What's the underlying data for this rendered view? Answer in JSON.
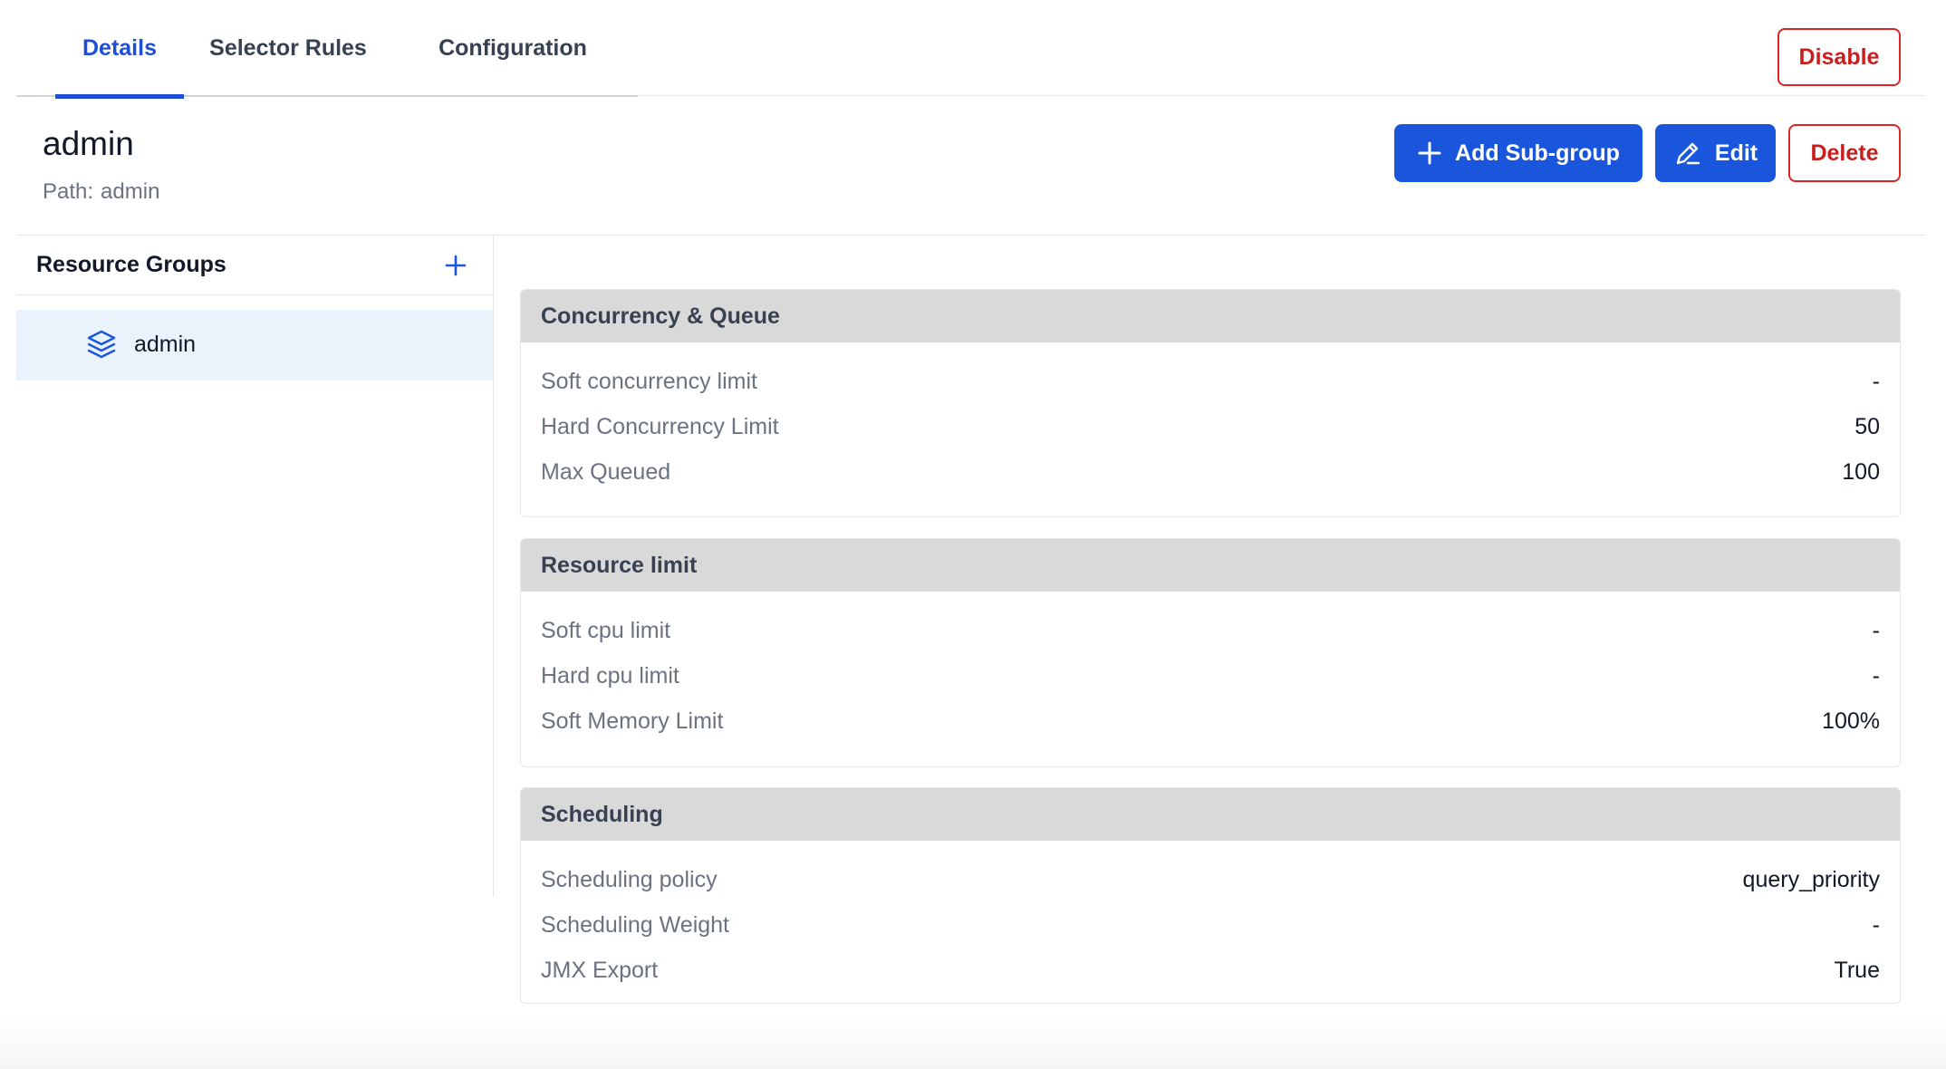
{
  "tabs": [
    {
      "label": "Details",
      "active": true
    },
    {
      "label": "Selector Rules",
      "active": false
    },
    {
      "label": "Configuration",
      "active": false
    }
  ],
  "actions": {
    "disable_label": "Disable",
    "add_subgroup_label": "Add Sub-group",
    "edit_label": "Edit",
    "delete_label": "Delete"
  },
  "group": {
    "name": "admin",
    "path_label": "Path:",
    "path_value": "admin"
  },
  "sidebar": {
    "title": "Resource Groups",
    "items": [
      {
        "label": "admin",
        "icon": "layers-icon",
        "selected": true
      }
    ]
  },
  "sections": [
    {
      "title": "Concurrency & Queue",
      "rows": [
        {
          "label": "Soft concurrency limit",
          "value": "-"
        },
        {
          "label": "Hard Concurrency Limit",
          "value": "50"
        },
        {
          "label": "Max Queued",
          "value": "100"
        }
      ]
    },
    {
      "title": "Resource limit",
      "rows": [
        {
          "label": "Soft cpu limit",
          "value": "-"
        },
        {
          "label": "Hard cpu limit",
          "value": "-"
        },
        {
          "label": "Soft Memory Limit",
          "value": "100%"
        }
      ]
    },
    {
      "title": "Scheduling",
      "rows": [
        {
          "label": "Scheduling policy",
          "value": "query_priority"
        },
        {
          "label": "Scheduling Weight",
          "value": "-"
        },
        {
          "label": "JMX Export",
          "value": "True"
        }
      ]
    }
  ],
  "colors": {
    "primary": "#1a56db",
    "danger": "#c81e1e",
    "selected_bg": "#eaf2fc",
    "section_header_bg": "#d9d9d9"
  }
}
